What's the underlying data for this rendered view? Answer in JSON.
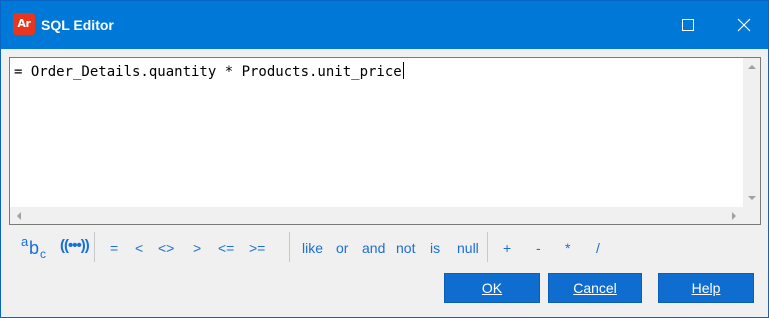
{
  "window": {
    "app_icon_text": "Ar",
    "title": "SQL Editor"
  },
  "editor": {
    "text": "= Order_Details.quantity * Products.unit_price"
  },
  "toolbar": {
    "abc_icon": {
      "a": "a",
      "b": "b",
      "c": "c"
    },
    "param_icon": "((•••))",
    "comparison_ops": [
      "=",
      "<",
      "<>",
      ">",
      "<=",
      ">="
    ],
    "logical_ops": [
      "like",
      "or",
      "and",
      "not",
      "is",
      "null"
    ],
    "arith_ops": [
      "+",
      "-",
      "*",
      "/"
    ]
  },
  "buttons": {
    "ok": "OK",
    "cancel": "Cancel",
    "help": "Help"
  },
  "colors": {
    "titlebar": "#0078d7",
    "accent": "#1a6fd6",
    "button": "#0f6dd0",
    "app_icon": "#e8351e"
  }
}
